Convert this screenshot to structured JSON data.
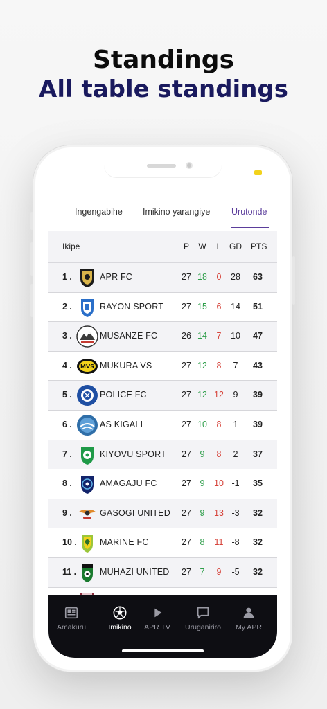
{
  "headline": {
    "title": "Standings",
    "subtitle": "All table standings"
  },
  "tabs": [
    {
      "label": "Ingengabihe",
      "active": false
    },
    {
      "label": "Imikino yarangiye",
      "active": false
    },
    {
      "label": "Urutonde",
      "active": true
    }
  ],
  "table": {
    "headers": {
      "team": "Ikipe",
      "p": "P",
      "w": "W",
      "l": "L",
      "gd": "GD",
      "pts": "PTS"
    },
    "rows": [
      {
        "pos": "1 .",
        "team": "APR FC",
        "p": "27",
        "w": "18",
        "l": "0",
        "gd": "28",
        "pts": "63",
        "logo": "apr-fc-logo"
      },
      {
        "pos": "2 .",
        "team": "RAYON SPORT",
        "p": "27",
        "w": "15",
        "l": "6",
        "gd": "14",
        "pts": "51",
        "logo": "rayon-sport-logo"
      },
      {
        "pos": "3 .",
        "team": "MUSANZE FC",
        "p": "26",
        "w": "14",
        "l": "7",
        "gd": "10",
        "pts": "47",
        "logo": "musanze-fc-logo"
      },
      {
        "pos": "4 .",
        "team": "MUKURA VS",
        "p": "27",
        "w": "12",
        "l": "8",
        "gd": "7",
        "pts": "43",
        "logo": "mukura-vs-logo"
      },
      {
        "pos": "5 .",
        "team": "POLICE FC",
        "p": "27",
        "w": "12",
        "l": "12",
        "gd": "9",
        "pts": "39",
        "logo": "police-fc-logo"
      },
      {
        "pos": "6 .",
        "team": "AS KIGALI",
        "p": "27",
        "w": "10",
        "l": "8",
        "gd": "1",
        "pts": "39",
        "logo": "as-kigali-logo"
      },
      {
        "pos": "7 .",
        "team": "KIYOVU SPORT",
        "p": "27",
        "w": "9",
        "l": "8",
        "gd": "2",
        "pts": "37",
        "logo": "kiyovu-sport-logo"
      },
      {
        "pos": "8 .",
        "team": "AMAGAJU FC",
        "p": "27",
        "w": "9",
        "l": "10",
        "gd": "-1",
        "pts": "35",
        "logo": "amagaju-fc-logo"
      },
      {
        "pos": "9 .",
        "team": "GASOGI UNITED",
        "p": "27",
        "w": "9",
        "l": "13",
        "gd": "-3",
        "pts": "32",
        "logo": "gasogi-united-logo"
      },
      {
        "pos": "10 .",
        "team": "MARINE FC",
        "p": "27",
        "w": "8",
        "l": "11",
        "gd": "-8",
        "pts": "32",
        "logo": "marine-fc-logo"
      },
      {
        "pos": "11 .",
        "team": "MUHAZI UNITED",
        "p": "27",
        "w": "7",
        "l": "9",
        "gd": "-5",
        "pts": "32",
        "logo": "muhazi-united-logo"
      }
    ]
  },
  "bottom_nav": [
    {
      "label": "Amakuru",
      "icon": "newspaper-icon",
      "active": false
    },
    {
      "label": "Imikino",
      "icon": "soccer-ball-icon",
      "active": true
    },
    {
      "label": "APR TV",
      "icon": "play-icon",
      "active": false
    },
    {
      "label": "Uruganiriro",
      "icon": "chat-icon",
      "active": false
    },
    {
      "label": "My APR",
      "icon": "user-icon",
      "active": false
    }
  ],
  "colors": {
    "accent": "#5b3d9b",
    "win": "#2e9e4a",
    "loss": "#d6443b",
    "nav_bg": "#0e0e13",
    "headline_subtitle": "#1a1a5e"
  }
}
